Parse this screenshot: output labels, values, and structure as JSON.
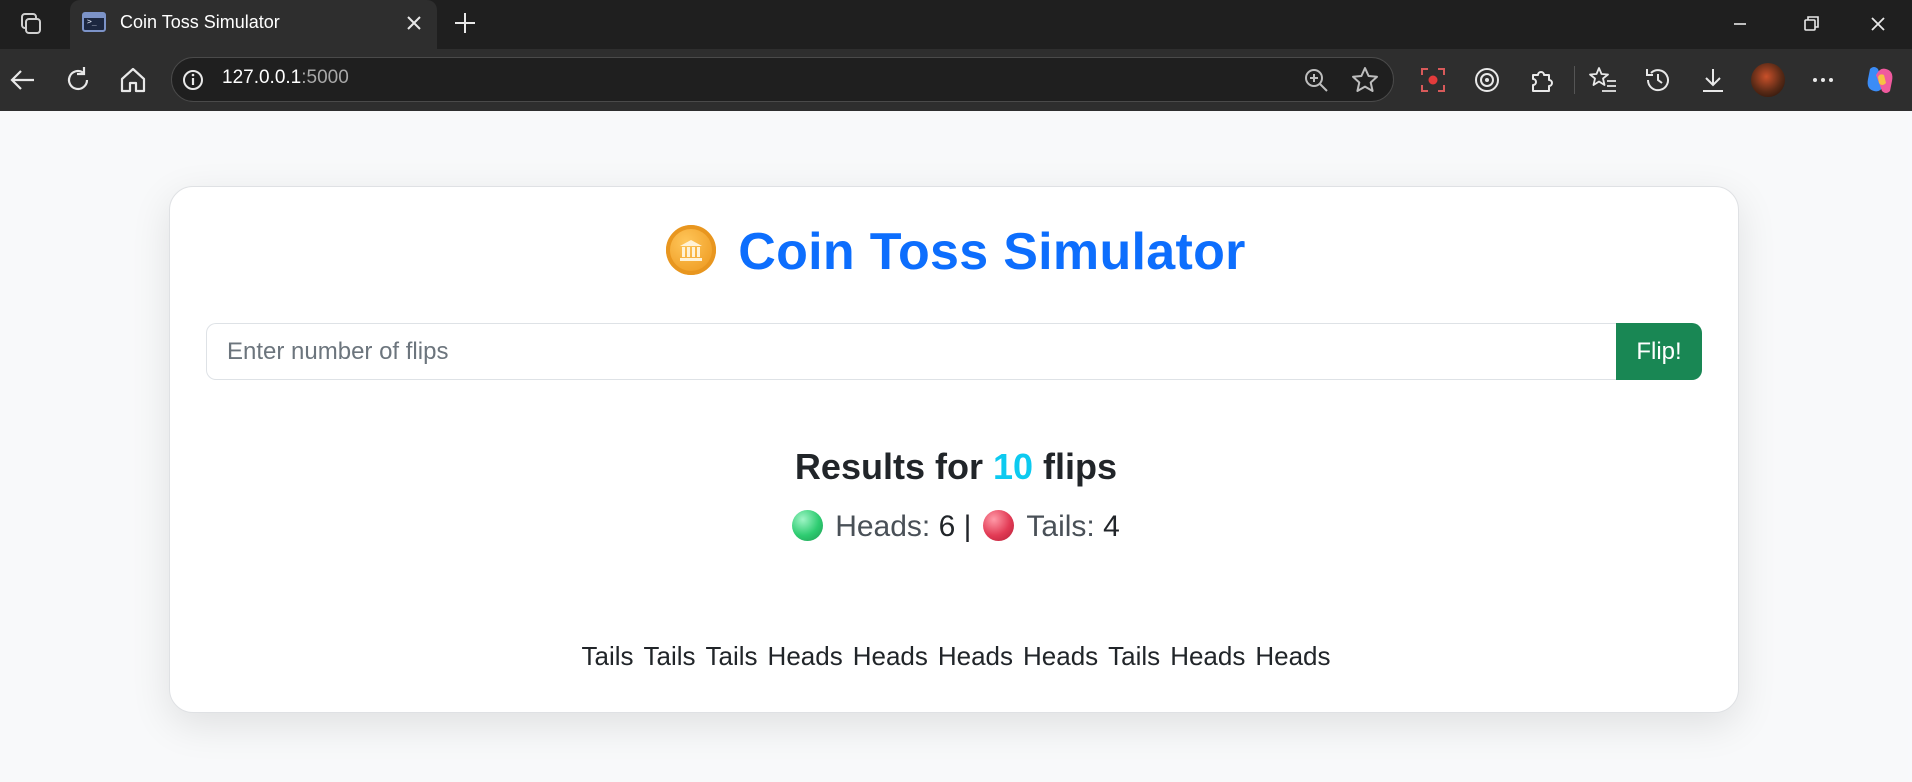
{
  "browser": {
    "tab_title": "Coin Toss Simulator",
    "url_host": "127.0.0.1",
    "url_port": ":5000"
  },
  "app": {
    "title": "Coin Toss Simulator",
    "input_placeholder": "Enter number of flips",
    "button_label": "Flip!",
    "results_prefix": "Results for",
    "flip_count": "10",
    "results_suffix": "flips",
    "heads_label": "Heads:",
    "heads_count": "6",
    "separator": "|",
    "tails_label": "Tails:",
    "tails_count": "4",
    "flips": [
      "Tails",
      "Tails",
      "Tails",
      "Heads",
      "Heads",
      "Heads",
      "Heads",
      "Tails",
      "Heads",
      "Heads"
    ]
  },
  "colors": {
    "title": "#0d6efd",
    "flip_button": "#198754",
    "count_highlight": "#0dcaf0",
    "heads_ball": "#2ecc71",
    "tails_ball": "#e23b55"
  }
}
